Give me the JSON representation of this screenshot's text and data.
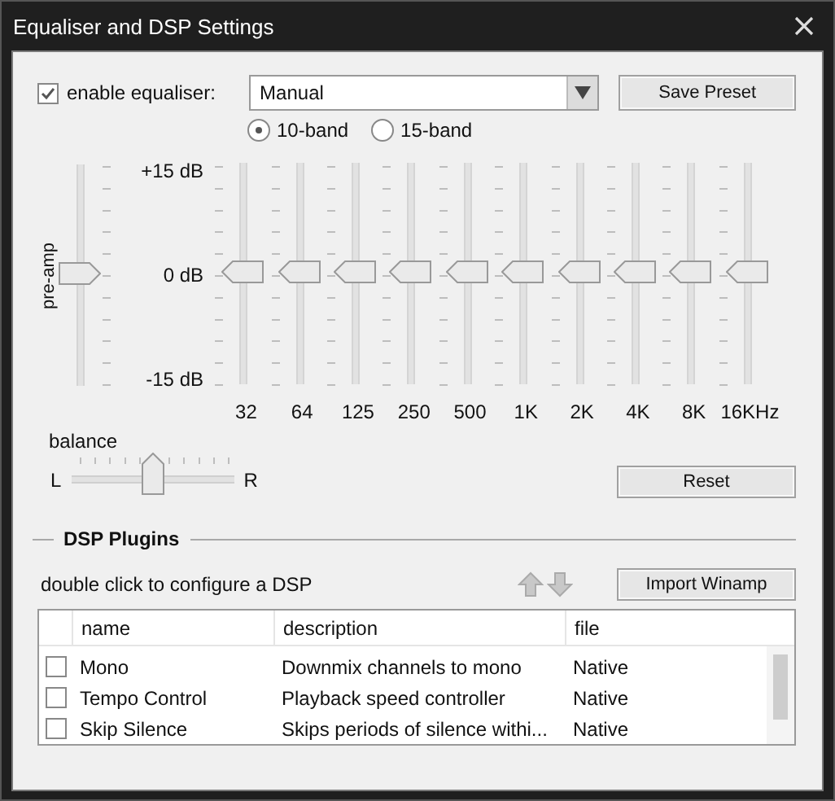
{
  "window": {
    "title": "Equaliser and DSP Settings"
  },
  "equaliser": {
    "enabled": true,
    "label": "enable equaliser:",
    "preset": "Manual",
    "save_button": "Save Preset",
    "band_modes": [
      {
        "label": "10-band",
        "selected": true
      },
      {
        "label": "15-band",
        "selected": false
      }
    ],
    "preamp": {
      "label": "pre-amp",
      "level": 0.5
    },
    "scale": [
      "+15 dB",
      "0 dB",
      "-15 dB"
    ],
    "bands": [
      {
        "label": "32",
        "level": 0.5
      },
      {
        "label": "64",
        "level": 0.5
      },
      {
        "label": "125",
        "level": 0.5
      },
      {
        "label": "250",
        "level": 0.5
      },
      {
        "label": "500",
        "level": 0.5
      },
      {
        "label": "1K",
        "level": 0.5
      },
      {
        "label": "2K",
        "level": 0.5
      },
      {
        "label": "4K",
        "level": 0.5
      },
      {
        "label": "8K",
        "level": 0.5
      },
      {
        "label": "16KHz",
        "level": 0.5
      }
    ],
    "balance": {
      "label": "balance",
      "left": "L",
      "right": "R",
      "level": 0.5
    },
    "reset_button": "Reset"
  },
  "dsp": {
    "title": "DSP Plugins",
    "hint": "double click to configure a DSP",
    "import_button": "Import Winamp",
    "columns": [
      "name",
      "description",
      "file"
    ],
    "rows": [
      {
        "checked": false,
        "name": "Mono",
        "description": "Downmix channels to mono",
        "file": "Native"
      },
      {
        "checked": false,
        "name": "Tempo Control",
        "description": "Playback speed controller",
        "file": "Native"
      },
      {
        "checked": false,
        "name": "Skip Silence",
        "description": "Skips periods of silence withi...",
        "file": "Native"
      }
    ]
  }
}
